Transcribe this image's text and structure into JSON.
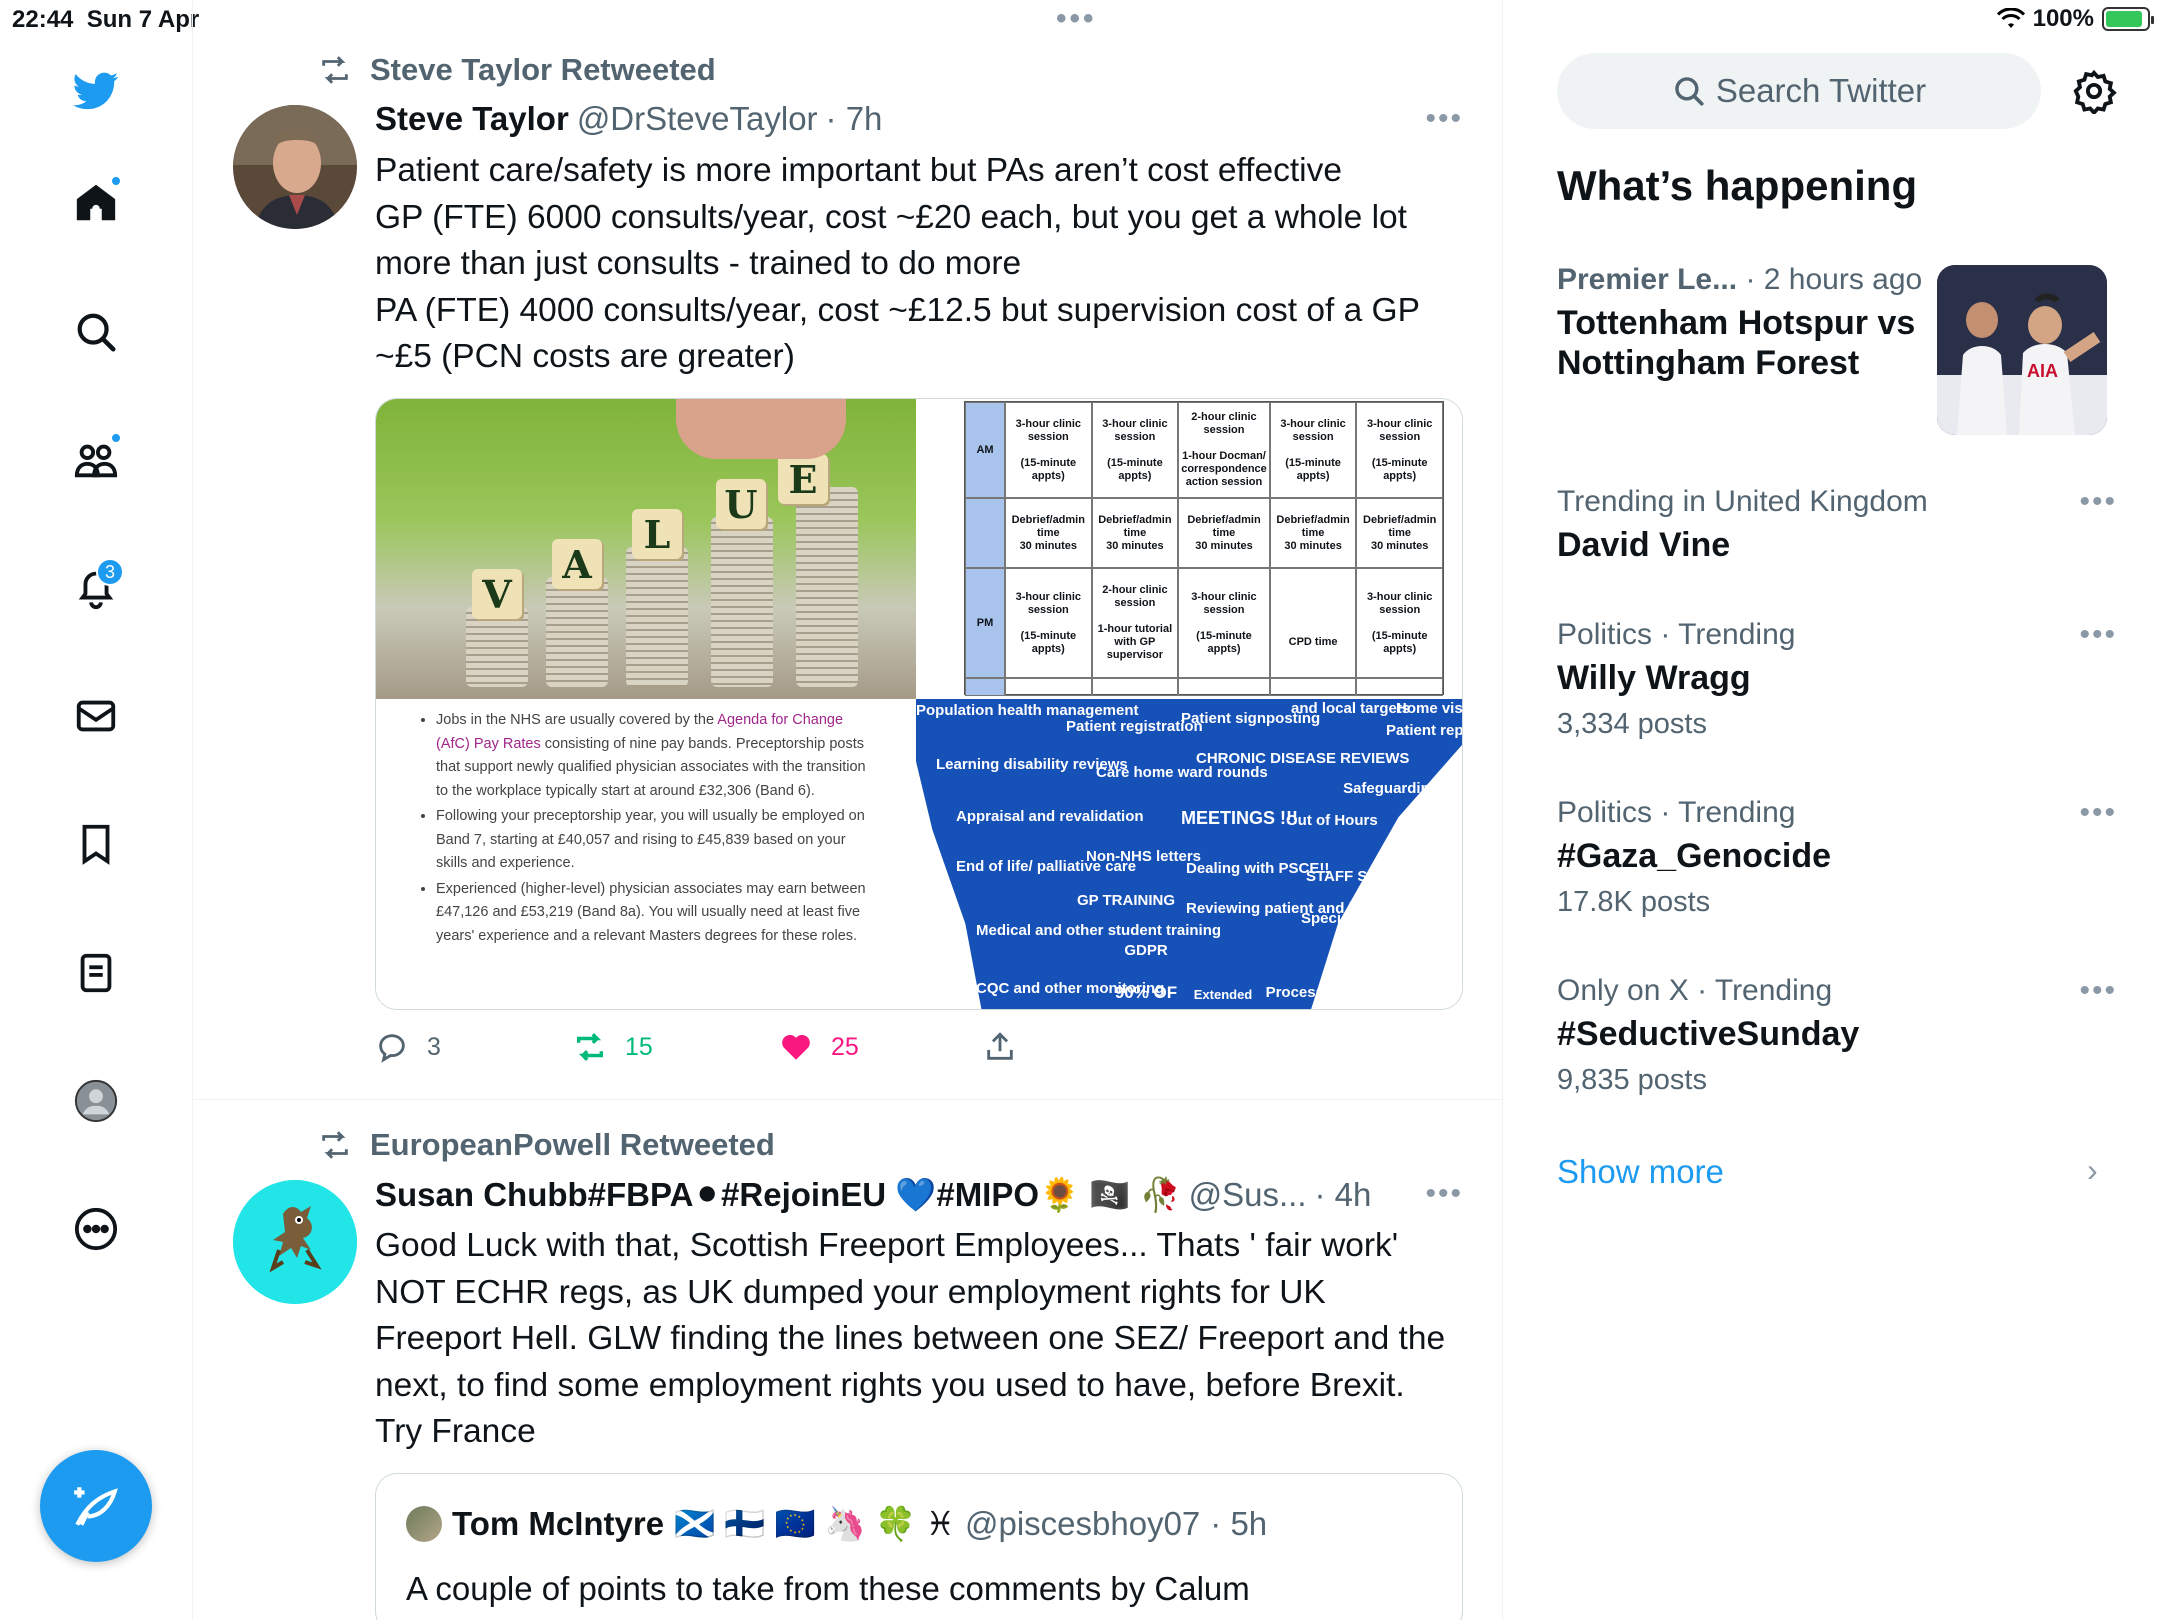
{
  "status": {
    "time": "22:44",
    "date": "Sun 7 Apr",
    "battery": "100%"
  },
  "nav": {
    "notifications_badge": "3"
  },
  "tweets": [
    {
      "retweeted_by": "Steve Taylor Retweeted",
      "name": "Steve Taylor",
      "handle": "@DrSteveTaylor",
      "time": "· 7h",
      "text": "Patient care/safety is more important but PAs aren’t cost effective\nGP (FTE) 6000 consults/year, cost ~£20 each, but you get a whole lot more than just consults - trained to do more\nPA (FTE) 4000 consults/year, cost ~£12.5 but supervision cost of a GP ~£5 (PCN costs are greater)",
      "replies": "3",
      "retweets": "15",
      "likes": "25",
      "media": {
        "value_letters": [
          "V",
          "A",
          "L",
          "U",
          "E"
        ],
        "schedule": {
          "rows": [
            "AM",
            "",
            "PM",
            ""
          ],
          "cells": [
            [
              "3-hour clinic session\n\n(15-minute appts)",
              "3-hour clinic session\n\n(15-minute appts)",
              "2-hour clinic session\n\n1-hour Docman/ correspondence action session",
              "3-hour clinic session\n\n(15-minute appts)",
              "3-hour clinic session\n\n(15-minute appts)"
            ],
            [
              "Debrief/admin time\n30 minutes",
              "Debrief/admin time\n30 minutes",
              "Debrief/admin time\n30 minutes",
              "Debrief/admin time\n30 minutes",
              "Debrief/admin time\n30 minutes"
            ],
            [
              "3-hour clinic session\n\n(15-minute appts)",
              "2-hour clinic session\n\n1-hour tutorial with GP supervisor",
              "3-hour clinic session\n\n(15-minute appts)",
              "\n\n\nCPD time",
              "3-hour clinic session\n\n(15-minute appts)"
            ],
            [
              "",
              "",
              "",
              "",
              ""
            ]
          ]
        },
        "bullets": [
          [
            "Jobs in the NHS are usually covered by the ",
            "Agenda for Change (AfC) Pay Rates",
            " consisting of nine pay bands. Preceptorship posts that support newly qualified physician associates with the transition to the workplace typically start at around £32,306 (Band 6)."
          ],
          [
            "Following your preceptorship year, you will usually be employed on Band 7, starting at £40,057 and rising to £45,839 based on your skills and experience.",
            "",
            ""
          ],
          [
            "Experienced (higher-level) physician associates may earn between £47,126 and £53,219 (Band 8a). You will usually need at least five years' experience and a relevant Masters degrees for these roles.",
            "",
            ""
          ]
        ],
        "cloud_words": [
          "Population health management",
          "Patient registration",
          "Patient signposting",
          "and local targets",
          "Home visits",
          "Patient reports",
          "Learning disability reviews",
          "Care home ward rounds",
          "CHRONIC DISEASE REVIEWS",
          "Safeguarding",
          "Appraisal and revalidation",
          "MEETINGS !!!",
          "Out of Hours",
          "End of life/ palliative care",
          "Non-NHS letters",
          "Dealing with PSCE!!",
          "STAFF SUPERVISION",
          "GP TRAINING",
          "Reviewing patient and hospital letters",
          "Specialist clinics",
          "Medical and other student training",
          "GDPR",
          "CQC and other monitoring",
          "90% OF",
          "Extended",
          "Processing"
        ]
      }
    },
    {
      "retweeted_by": "EuropeanPowell Retweeted",
      "name": "Susan Chubb#FBPA⚫#RejoinEU 💙#MIPO🌻 🏴‍☠️ 🥀",
      "handle": "@Sus...",
      "time": "· 4h",
      "text": "Good Luck with that, Scottish Freeport Employees... Thats ' fair work' NOT ECHR regs, as UK dumped your employment rights for UK Freeport Hell. GLW finding the lines between one SEZ/ Freeport and the next, to find some employment rights you used to have, before Brexit. Try France",
      "quote": {
        "name": "Tom McIntyre",
        "flags": "🏴󠁧󠁢󠁳󠁣󠁴󠁿 🇫🇮 🇪🇺 🦄 🍀 ♓",
        "handle": "@piscesbhoy07",
        "time": "· 5h",
        "text": "A couple of points to take from these comments by Calum"
      }
    }
  ],
  "sidebar": {
    "search_placeholder": "Search Twitter",
    "whats_happening": "What’s happening",
    "trends": [
      {
        "meta": "Premier Le...",
        "meta2": "· 2 hours ago",
        "title": "Tottenham Hotspur vs Nottingham Forest",
        "count": ""
      },
      {
        "meta": "Trending in United Kingdom",
        "meta2": "",
        "title": "David Vine",
        "count": ""
      },
      {
        "meta": "Politics · Trending",
        "meta2": "",
        "title": "Willy Wragg",
        "count": "3,334 posts"
      },
      {
        "meta": "Politics · Trending",
        "meta2": "",
        "title": "#Gaza_Genocide",
        "count": "17.8K posts"
      },
      {
        "meta": "Only on X · Trending",
        "meta2": "",
        "title": "#SeductiveSunday",
        "count": "9,835 posts"
      }
    ],
    "show_more": "Show more",
    "trend_image_text": "AIA"
  },
  "colors": {
    "accent": "#1d9bf0",
    "retweet": "#00ba7c",
    "like": "#f91880",
    "text": "#0f1419",
    "secondary": "#536471"
  }
}
